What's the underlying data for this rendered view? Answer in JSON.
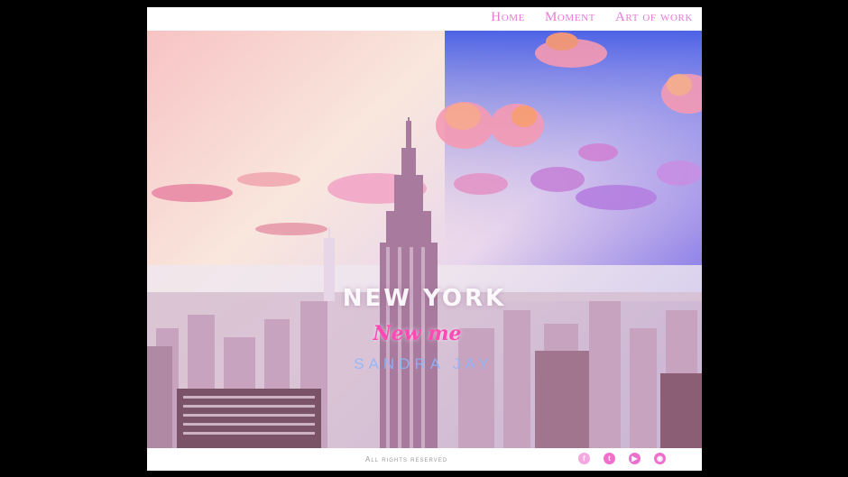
{
  "nav": {
    "items": [
      {
        "label": "Home"
      },
      {
        "label": "Moment"
      },
      {
        "label": "Art of work"
      }
    ]
  },
  "hero": {
    "title": "NEW YORK",
    "subtitle": "New me",
    "author": "SANDRA JAY"
  },
  "footer": {
    "rights": "All rights reserved",
    "social": [
      {
        "icon": "facebook-icon",
        "glyph": "f"
      },
      {
        "icon": "twitter-icon",
        "glyph": "t"
      },
      {
        "icon": "youtube-icon",
        "glyph": "▶"
      },
      {
        "icon": "rss-icon",
        "glyph": "◉"
      }
    ]
  },
  "colors": {
    "nav_text": "#e67ad6",
    "accent_pink": "#ff49b4",
    "author_blue": "#8bb7ff",
    "social_pink": "#ef6fcc"
  }
}
